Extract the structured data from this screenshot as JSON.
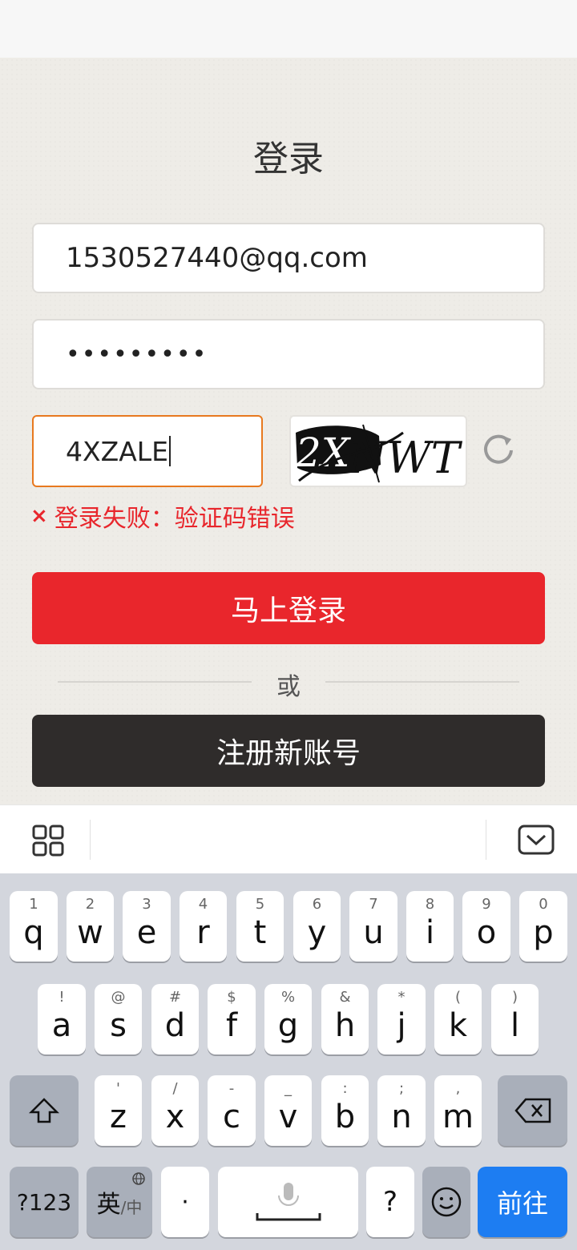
{
  "page": {
    "title": "登录",
    "email_value": "1530527440@qq.com",
    "password_value": "•••••••••",
    "captcha_value": "4XZALE",
    "captcha_image_text": "2XNWT",
    "error_icon": "×",
    "error_message": "登录失败：验证码错误",
    "login_button": "马上登录",
    "or_text": "或",
    "register_button": "注册新账号"
  },
  "colors": {
    "accent_red": "#e9262c",
    "dark_button": "#2f2c2b",
    "focus_border": "#e8791f",
    "keyboard_action": "#1d7df2"
  },
  "keyboard": {
    "row1": [
      {
        "sub": "1",
        "main": "q"
      },
      {
        "sub": "2",
        "main": "w"
      },
      {
        "sub": "3",
        "main": "e"
      },
      {
        "sub": "4",
        "main": "r"
      },
      {
        "sub": "5",
        "main": "t"
      },
      {
        "sub": "6",
        "main": "y"
      },
      {
        "sub": "7",
        "main": "u"
      },
      {
        "sub": "8",
        "main": "i"
      },
      {
        "sub": "9",
        "main": "o"
      },
      {
        "sub": "0",
        "main": "p"
      }
    ],
    "row2": [
      {
        "sub": "!",
        "main": "a"
      },
      {
        "sub": "@",
        "main": "s"
      },
      {
        "sub": "#",
        "main": "d"
      },
      {
        "sub": "$",
        "main": "f"
      },
      {
        "sub": "%",
        "main": "g"
      },
      {
        "sub": "&",
        "main": "h"
      },
      {
        "sub": "*",
        "main": "j"
      },
      {
        "sub": "(",
        "main": "k"
      },
      {
        "sub": ")",
        "main": "l"
      }
    ],
    "row3": [
      {
        "sub": "'",
        "main": "z"
      },
      {
        "sub": "/",
        "main": "x"
      },
      {
        "sub": "-",
        "main": "c"
      },
      {
        "sub": "_",
        "main": "v"
      },
      {
        "sub": ":",
        "main": "b"
      },
      {
        "sub": ";",
        "main": "n"
      },
      {
        "sub": ",",
        "main": "m"
      }
    ],
    "symbols_key": "?123",
    "lang_key": "英",
    "lang_key_sub": "/中",
    "dot_key": "·",
    "question_key": "?",
    "action_key": "前往"
  }
}
